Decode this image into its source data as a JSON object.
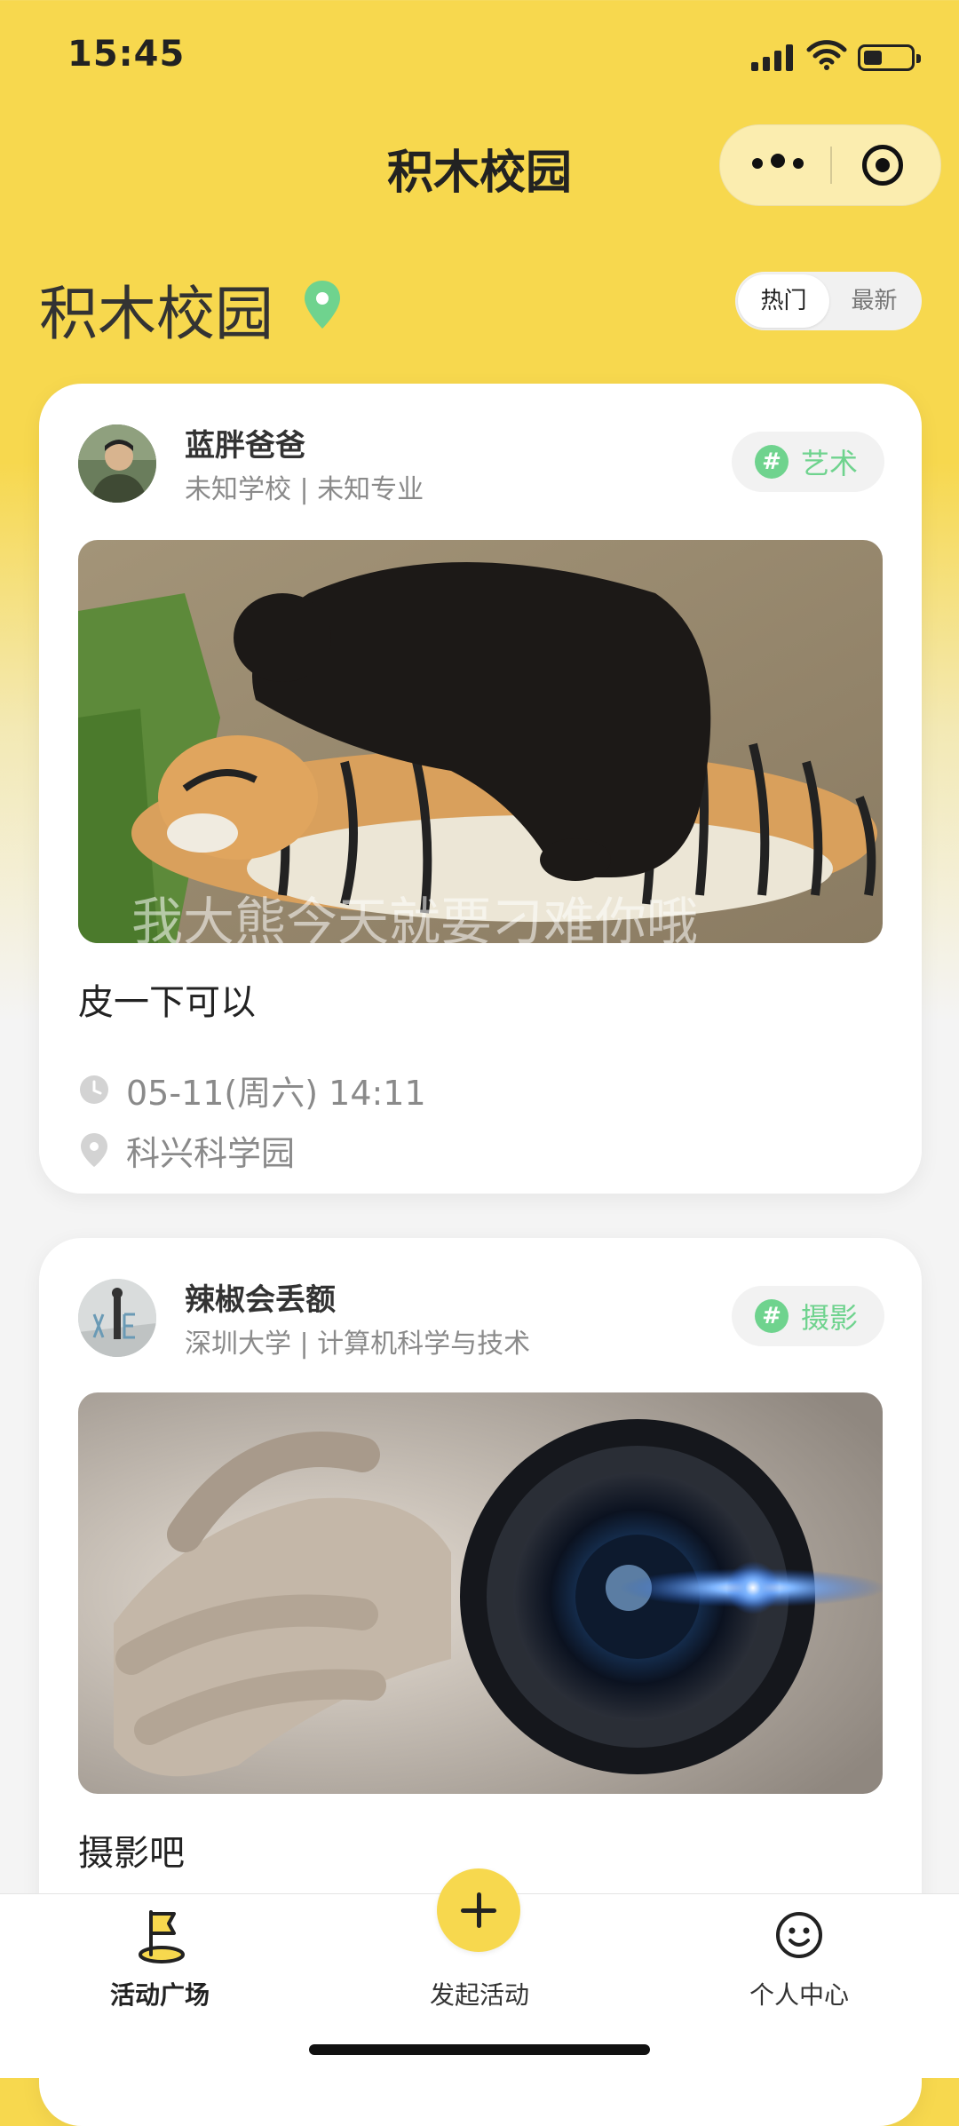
{
  "status_bar": {
    "time": "15:45"
  },
  "navbar": {
    "title": "积木校园"
  },
  "header": {
    "campus_name": "积木校园",
    "sort_options": [
      "热门",
      "最新"
    ]
  },
  "posts": [
    {
      "author": "蓝胖爸爸",
      "school": "未知学校 | 未知专业",
      "tag": "艺术",
      "image_caption_text": "我大熊今天就要刁难你哦",
      "text": "皮一下可以",
      "datetime": "05-11(周六) 14:11",
      "location": "科兴科学园"
    },
    {
      "author": "辣椒会丢额",
      "school": "深圳大学 | 计算机科学与技术",
      "tag": "摄影",
      "text": "摄影吧"
    }
  ],
  "tabbar": {
    "items": [
      {
        "label": "活动广场",
        "icon": "flag-icon"
      },
      {
        "label": "发起活动",
        "icon": "plus-icon"
      },
      {
        "label": "个人中心",
        "icon": "smile-icon"
      }
    ]
  },
  "colors": {
    "brand_yellow": "#F7D84E",
    "tag_green": "#6FD38E",
    "text_gray": "#8A8A8A"
  }
}
